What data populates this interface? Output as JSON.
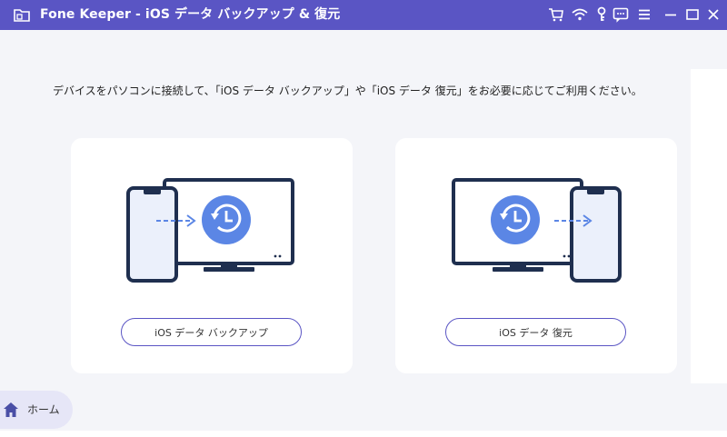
{
  "titlebar": {
    "title": "Fone Keeper - iOS データ バックアップ & 復元",
    "icons": [
      "cart-icon",
      "wifi-icon",
      "key-icon",
      "chat-icon",
      "menu-icon",
      "minimize-icon",
      "maximize-icon",
      "close-icon"
    ]
  },
  "main": {
    "instruction": "デバイスをパソコンに接続して、「iOS データ バックアップ」や「iOS データ 復元」をお必要に応じてご利用ください。",
    "cards": [
      {
        "button_label": "iOS データ バックアップ",
        "illustration": "phone-to-computer-backup"
      },
      {
        "button_label": "iOS データ 復元",
        "illustration": "computer-to-phone-restore"
      }
    ]
  },
  "sidebar": {
    "home_label": "ホーム"
  },
  "colors": {
    "titlebar": "#5a55c4",
    "accent_blue": "#5b86e5",
    "device_outline": "#1f2f4f",
    "background": "#f4f5f9"
  }
}
